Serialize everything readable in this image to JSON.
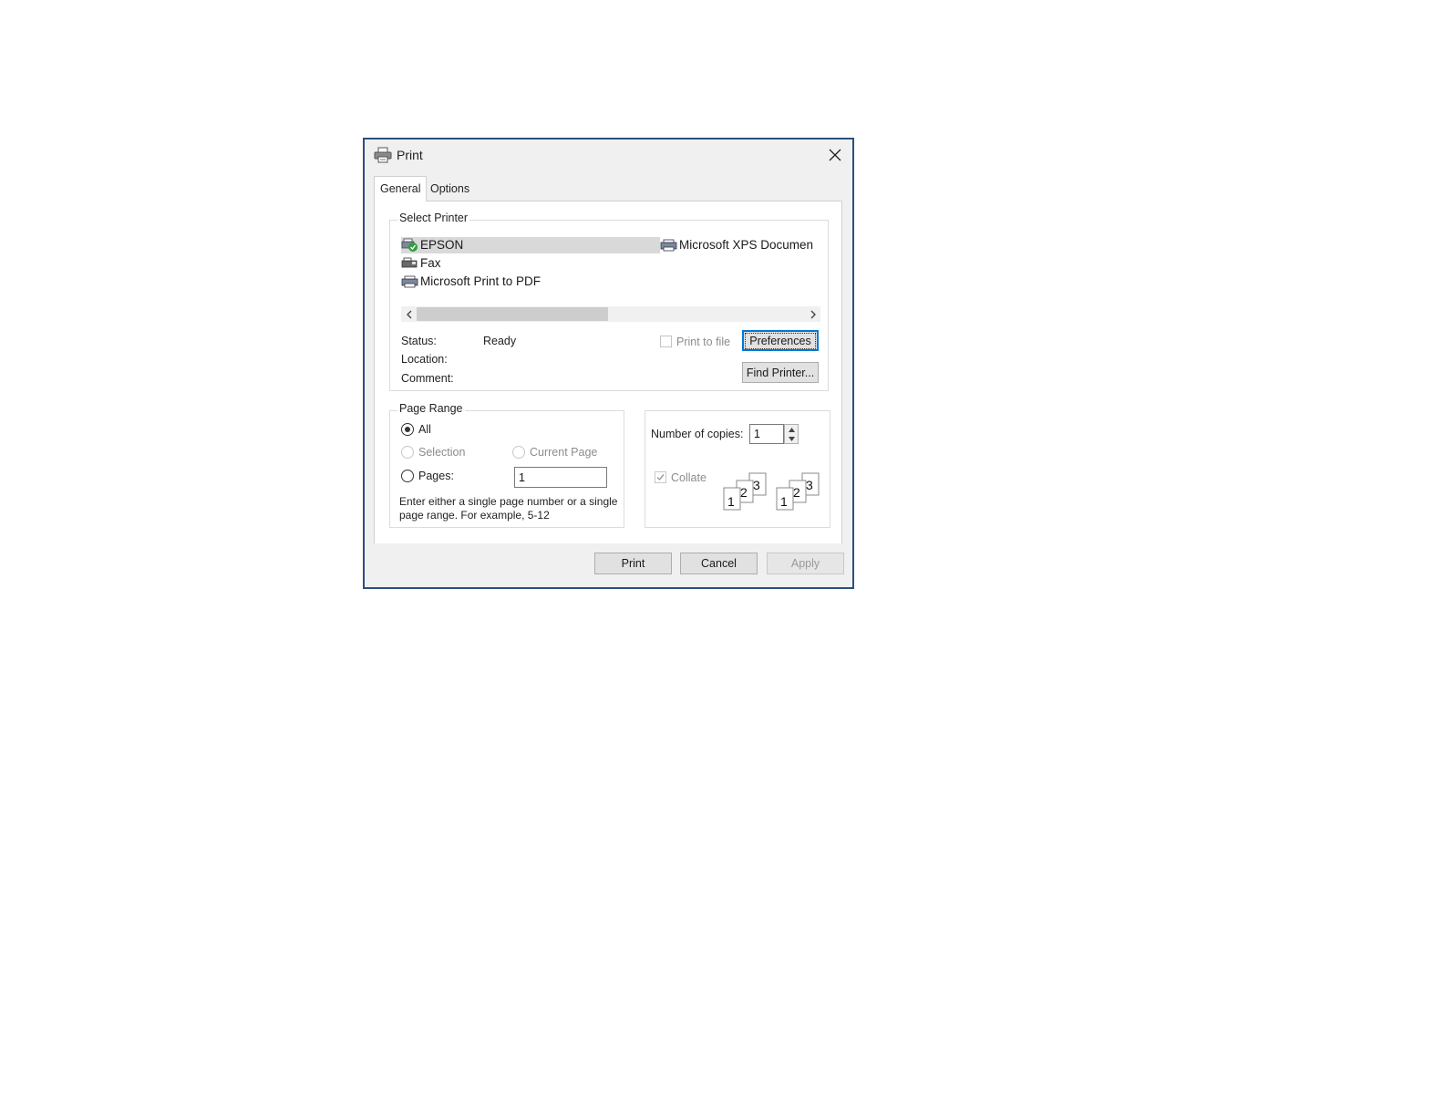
{
  "dialog": {
    "title": "Print",
    "tabs": [
      {
        "label": "General",
        "active": true
      },
      {
        "label": "Options",
        "active": false
      }
    ]
  },
  "select_printer": {
    "legend": "Select Printer",
    "printers": [
      {
        "name": "EPSON",
        "icon": "printer-default-icon",
        "selected": true
      },
      {
        "name": "Fax",
        "icon": "fax-icon",
        "selected": false
      },
      {
        "name": "Microsoft Print to PDF",
        "icon": "printer-icon",
        "selected": false
      },
      {
        "name": "Microsoft XPS Documen",
        "icon": "printer-icon",
        "selected": false
      }
    ],
    "status_label": "Status:",
    "status_value": "Ready",
    "location_label": "Location:",
    "location_value": "",
    "comment_label": "Comment:",
    "comment_value": "",
    "print_to_file_label": "Print to file",
    "print_to_file_checked": false,
    "preferences_label": "Preferences",
    "find_printer_label": "Find Printer..."
  },
  "page_range": {
    "legend": "Page Range",
    "all_label": "All",
    "selection_label": "Selection",
    "current_page_label": "Current Page",
    "pages_label": "Pages:",
    "pages_value": "1",
    "selected_option": "All",
    "hint_line1": "Enter either a single page number or a single",
    "hint_line2": "page range.  For example, 5-12"
  },
  "copies": {
    "number_label": "Number of copies:",
    "number_value": "1",
    "collate_label": "Collate",
    "collate_checked": true,
    "collate_pages": [
      "1",
      "2",
      "3"
    ]
  },
  "footer": {
    "print_label": "Print",
    "cancel_label": "Cancel",
    "apply_label": "Apply"
  },
  "colors": {
    "window_border": "#2b4f7f",
    "focus_blue": "#0078d7",
    "selected_row": "#d9d9d9",
    "default_badge": "#2e9e3e"
  }
}
